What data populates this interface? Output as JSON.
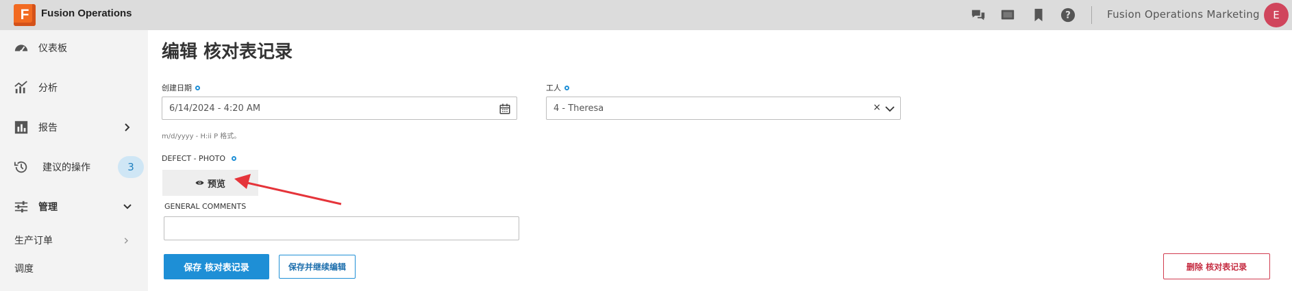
{
  "app": {
    "logo_letter": "F",
    "title": "Fusion Operations",
    "org_name": "Fusion Operations Marketing",
    "avatar_initial": "E"
  },
  "topbar_icons": [
    "chat-icon",
    "screen-icon",
    "bookmark-icon",
    "help-icon"
  ],
  "sidebar": {
    "items": [
      {
        "label": "仪表板",
        "icon": "dashboard-icon"
      },
      {
        "label": "分析",
        "icon": "analytics-icon"
      },
      {
        "label": "报告",
        "icon": "report-icon",
        "chevron": "right"
      },
      {
        "label": "建议的操作",
        "icon": "history-icon",
        "badge": "3"
      },
      {
        "label": "管理",
        "icon": "sliders-icon",
        "chevron": "down"
      }
    ],
    "sub_items": [
      {
        "label": "生产订单",
        "chevron": "right"
      },
      {
        "label": "调度"
      }
    ]
  },
  "page": {
    "title": "编辑 核对表记录",
    "created_date": {
      "label": "创建日期",
      "value": "6/14/2024 - 4:20 AM",
      "hint": "m/d/yyyy - H:ii P 格式。"
    },
    "worker": {
      "label": "工人",
      "value": "4 - Theresa"
    },
    "defect_photo": {
      "label": "DEFECT - PHOTO",
      "preview_label": "预览"
    },
    "general_comments": {
      "label": "GENERAL COMMENTS",
      "value": ""
    },
    "buttons": {
      "save": "保存 核对表记录",
      "save_continue": "保存并继续编辑",
      "delete": "删除 核对表记录"
    }
  },
  "colors": {
    "accent": "#1e8fd6",
    "danger": "#c52b40",
    "arrow": "#e5343a",
    "logo": "#f26a21"
  }
}
